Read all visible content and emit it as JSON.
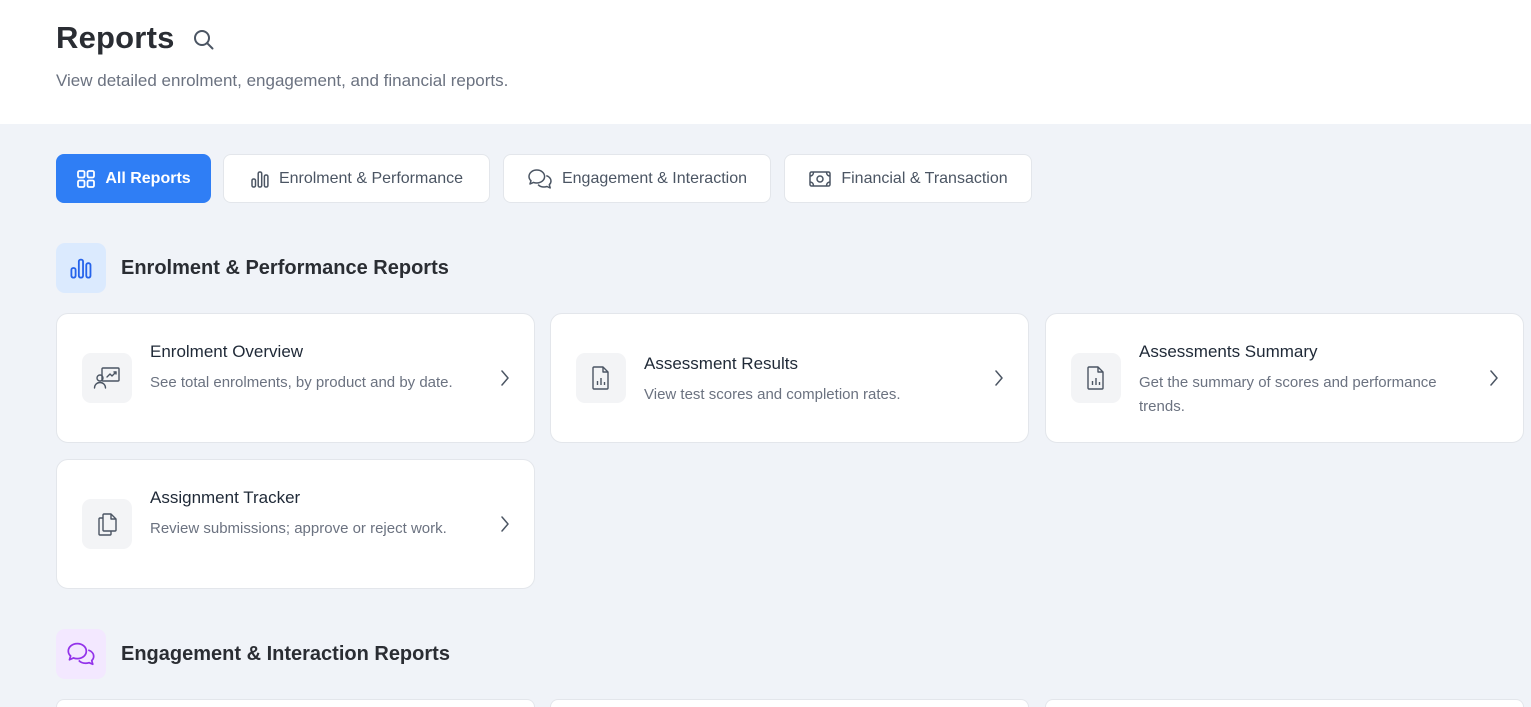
{
  "header": {
    "title": "Reports",
    "subtitle": "View detailed enrolment, engagement, and financial reports."
  },
  "tabs": [
    {
      "label": "All Reports",
      "icon": "grid-icon",
      "active": true
    },
    {
      "label": "Enrolment & Performance",
      "icon": "bar-chart-icon",
      "active": false
    },
    {
      "label": "Engagement & Interaction",
      "icon": "chat-bubbles-icon",
      "active": false
    },
    {
      "label": "Financial & Transaction",
      "icon": "banknote-icon",
      "active": false
    }
  ],
  "sections": [
    {
      "title": "Enrolment & Performance Reports",
      "icon": "bar-chart-icon",
      "cards": [
        {
          "title": "Enrolment Overview",
          "description": "See total enrolments, by product and by date.",
          "icon": "user-presentation-icon"
        },
        {
          "title": "Assessment Results",
          "description": "View test scores and completion rates.",
          "icon": "file-chart-icon"
        },
        {
          "title": "Assessments Summary",
          "description": "Get the summary of scores and performance trends.",
          "icon": "file-chart-icon"
        },
        {
          "title": "Assignment Tracker",
          "description": "Review submissions; approve or reject work.",
          "icon": "copy-files-icon"
        }
      ]
    },
    {
      "title": "Engagement & Interaction Reports",
      "icon": "chat-bubbles-icon"
    }
  ],
  "colors": {
    "accent": "#2f7ef5",
    "page_bg": "#f0f3f8",
    "enrolment_icon_bg": "#dbeafe",
    "engagement_icon_bg": "#f3e8ff"
  }
}
